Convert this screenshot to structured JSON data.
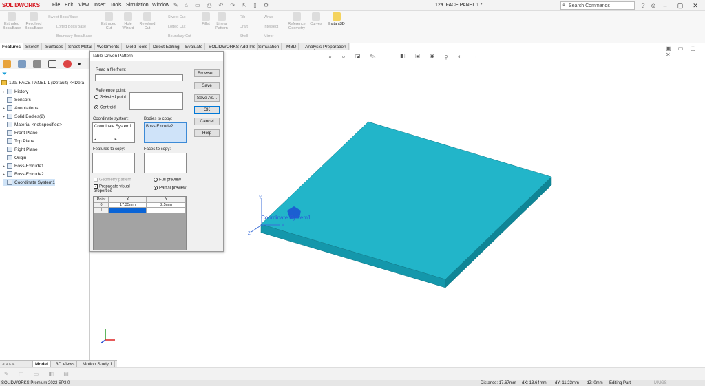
{
  "app": {
    "logo": "SOLIDWORKS",
    "doc_title": "12a. FACE PANEL 1 *",
    "search_placeholder": "Search Commands",
    "menu": [
      "File",
      "Edit",
      "View",
      "Insert",
      "Tools",
      "Simulation",
      "Window"
    ]
  },
  "ribbon": {
    "extruded_boss": "Extruded Boss/Base",
    "revolved_boss": "Revolved Boss/Base",
    "swept_boss": "Swept Boss/Base",
    "lofted_boss": "Lofted Boss/Base",
    "boundary_boss": "Boundary Boss/Base",
    "extruded_cut": "Extruded Cut",
    "hole_wizard": "Hole Wizard",
    "revolved_cut": "Revolved Cut",
    "swept_cut": "Swept Cut",
    "lofted_cut": "Lofted Cut",
    "boundary_cut": "Boundary Cut",
    "fillet": "Fillet",
    "linear_pattern": "Linear Pattern",
    "rib": "Rib",
    "draft": "Draft",
    "shell": "Shell",
    "wrap": "Wrap",
    "intersect": "Intersect",
    "mirror": "Mirror",
    "reference_geometry": "Reference Geometry",
    "curves": "Curves",
    "instant3d": "Instant3D"
  },
  "tabs": [
    "Features",
    "Sketch",
    "Surfaces",
    "Sheet Metal",
    "Weldments",
    "Mold Tools",
    "Direct Editing",
    "Evaluate",
    "SOLIDWORKS Add-Ins",
    "Simulation",
    "MBD",
    "Analysis Preparation"
  ],
  "tree": {
    "root": "12a. FACE PANEL 1 (Default) <<Defa",
    "items": [
      "History",
      "Sensors",
      "Annotations",
      "Solid Bodies(2)",
      "Material <not specified>",
      "Front Plane",
      "Top Plane",
      "Right Plane",
      "Origin",
      "Boss-Extrude1",
      "Boss-Extrude2",
      "Coordinate System1"
    ]
  },
  "dialog": {
    "title": "Table Driven Pattern",
    "read_file_label": "Read a file from:",
    "reference_point_label": "Reference point:",
    "selected_point": "Selected point",
    "centroid": "Centroid",
    "coord_system_label": "Coordinate system:",
    "coord_system_value": "Coordinate System1",
    "bodies_label": "Bodies to copy:",
    "bodies_value": "Boss-Extrude2",
    "features_label": "Features to copy:",
    "faces_label": "Faces to copy:",
    "geometry_pattern": "Geometry pattern",
    "propagate": "Propagate visual properties",
    "full_preview": "Full preview",
    "partial_preview": "Partial preview",
    "buttons": {
      "browse": "Browse...",
      "save": "Save",
      "save_as": "Save As...",
      "ok": "OK",
      "cancel": "Cancel",
      "help": "Help"
    },
    "table": {
      "headers": [
        "Point",
        "X",
        "Y"
      ],
      "rows": [
        [
          "0",
          "17.35mm",
          "2.5mm"
        ],
        [
          "1",
          "",
          ""
        ]
      ]
    }
  },
  "viewport": {
    "coord_label": "Coordinate System1",
    "body_color": "#1eb2c8"
  },
  "bottom_tabs": [
    "Model",
    "3D Views",
    "Motion Study 1"
  ],
  "status": {
    "version": "SOLIDWORKS Premium 2022 SP3.0",
    "distance": "Distance: 17.67mm",
    "dx": "dX: 13.64mm",
    "dy": "dY: 11.23mm",
    "dz": "dZ: 0mm",
    "mode": "Editing Part",
    "units": "MMGS"
  }
}
